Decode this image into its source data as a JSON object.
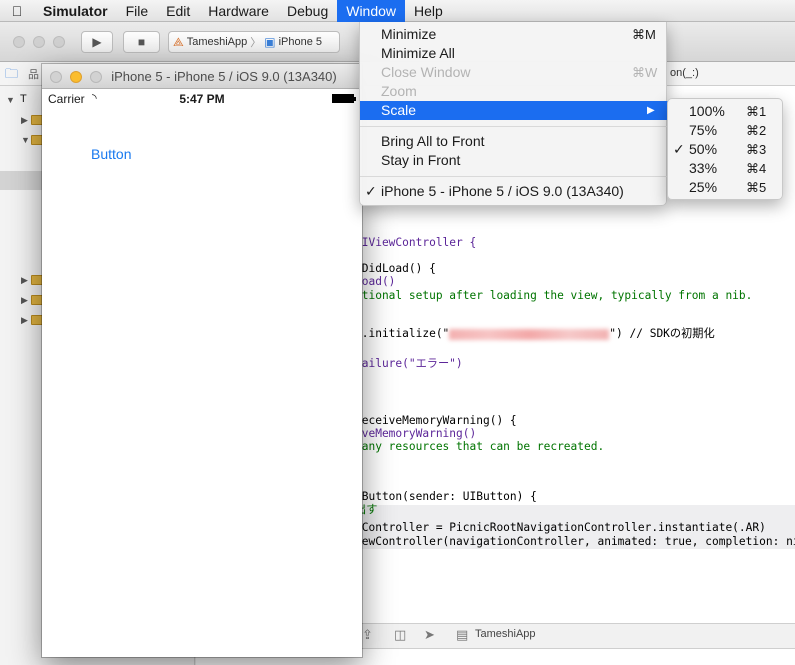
{
  "menubar": {
    "apple_icon": "apple-logo",
    "items": [
      "Simulator",
      "File",
      "Edit",
      "Hardware",
      "Debug",
      "Window",
      "Help"
    ],
    "active_item": "Window"
  },
  "xcode": {
    "scheme_app": "TameshiApp",
    "scheme_device": "iPhone 5",
    "jump_bar_right": "on(_:)",
    "debug_target": "TameshiApp",
    "navigator_first_letter": "T"
  },
  "code": {
    "class_decl": "UIViewController {",
    "view_did_load": "wDidLoad() {",
    "super_load": "Load()",
    "comment_setup": "itional setup after loading the view, typically from a nib.",
    "init_prefix": "t.initialize(\"",
    "init_suffix": "\") // SDKの初期化",
    "failure": "Failure(\"エラー\")",
    "memory_warning": "ReceiveMemoryWarning() {",
    "memory_warning_super": "iveMemoryWarning()",
    "comment_recreate": " any resources that can be recreated.",
    "tap_button": "pButton(sender: UIButton) {",
    "comment_call": "出す",
    "nav_controller": "nController = PicnicRootNavigationController.instantiate(.AR)",
    "present": "iewController(navigationController, animated: true, completion: ni"
  },
  "simulator": {
    "window_title": "iPhone 5 - iPhone 5 / iOS 9.0 (13A340)",
    "carrier": "Carrier",
    "time": "5:47 PM",
    "app_button": "Button"
  },
  "window_menu": {
    "minimize": "Minimize",
    "minimize_shortcut": "⌘M",
    "minimize_all": "Minimize All",
    "close_window": "Close Window",
    "close_shortcut": "⌘W",
    "zoom": "Zoom",
    "scale": "Scale",
    "bring_all": "Bring All to Front",
    "stay_front": "Stay in Front",
    "device_item": "iPhone 5 - iPhone 5 / iOS 9.0 (13A340)"
  },
  "scale_menu": [
    {
      "label": "100%",
      "shortcut": "⌘1"
    },
    {
      "label": "75%",
      "shortcut": "⌘2"
    },
    {
      "label": "50%",
      "shortcut": "⌘3"
    },
    {
      "label": "33%",
      "shortcut": "⌘4"
    },
    {
      "label": "25%",
      "shortcut": "⌘5"
    }
  ],
  "scale_selected": "50%"
}
